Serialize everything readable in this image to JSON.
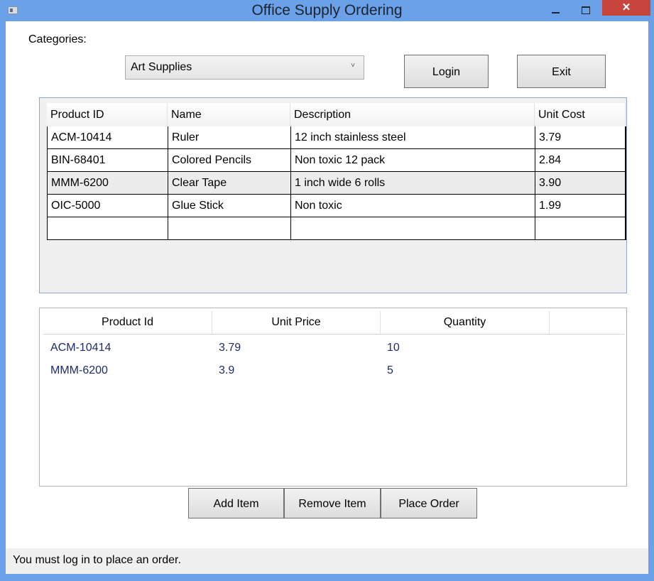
{
  "window": {
    "title": "Office Supply Ordering",
    "close_glyph": "✕"
  },
  "categories": {
    "label": "Categories:",
    "selected": "Art Supplies",
    "arrow": "˅"
  },
  "buttons": {
    "login": "Login",
    "exit": "Exit",
    "add_item": "Add Item",
    "remove_item": "Remove Item",
    "place_order": "Place Order"
  },
  "products": {
    "columns": [
      "Product ID",
      "Name",
      "Description",
      "Unit Cost"
    ],
    "rows": [
      [
        "ACM-10414",
        "Ruler",
        "12 inch stainless steel",
        "3.79"
      ],
      [
        "BIN-68401",
        "Colored Pencils",
        "Non toxic 12 pack",
        "2.84"
      ],
      [
        "MMM-6200",
        "Clear Tape",
        "1 inch wide 6 rolls",
        "3.90"
      ],
      [
        "OIC-5000",
        "Glue Stick",
        "Non toxic",
        "1.99"
      ],
      [
        "",
        "",
        "",
        ""
      ]
    ]
  },
  "order": {
    "columns": [
      "Product Id",
      "Unit Price",
      "Quantity"
    ],
    "rows": [
      [
        "ACM-10414",
        "3.79",
        "10"
      ],
      [
        "MMM-6200",
        "3.9",
        "5"
      ]
    ]
  },
  "status": {
    "text": "You must log in to place an order."
  },
  "colors": {
    "window_frame": "#6aa1e8",
    "close_button": "#c7453c",
    "order_text": "#1e2b6e"
  }
}
